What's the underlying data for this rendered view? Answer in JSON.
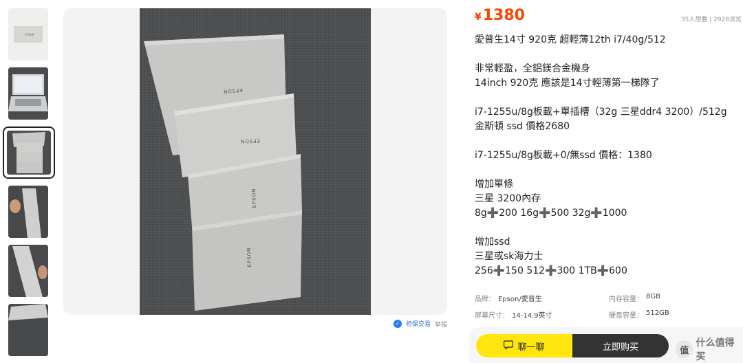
{
  "listing": {
    "currency_symbol": "¥",
    "price": "1380",
    "stats": "35人想要 | 2928浏览",
    "description": [
      "愛普生14寸 920克 超輕薄12th i7/40g/512",
      "",
      "非常輕盈，全鋁鎂合金機身",
      "14inch 920克 應該是14寸輕薄第一梯隊了",
      "",
      "i7-1255u/8g板載+單插槽（32g 三星ddr4 3200）/512g 金斯頓 ssd 價格2680",
      "",
      "i7-1255u/8g板載+0/無ssd 價格：1380",
      "",
      "增加單條",
      "三星 3200內存",
      "8g➕200 16g➕500 32g➕1000",
      "",
      "增加ssd",
      "三星或sk海力士",
      "256➕150 512➕300 1TB➕600"
    ]
  },
  "specs": {
    "brand_key": "品牌：",
    "brand_val": "Epson/愛普生",
    "memory_key": "内存容量：",
    "memory_val": "8GB",
    "screen_key": "屏幕尺寸：",
    "screen_val": "14-14.9英寸",
    "disk_key": "硬盘容量：",
    "disk_val": "512GB"
  },
  "photo": {
    "brand_text": "EPSON"
  },
  "share": {
    "label": "担保交易",
    "icon": "shield-check-icon",
    "report": "举报"
  },
  "actions": {
    "chat_label": "聊一聊",
    "chat_icon": "chat-bubble-icon",
    "buy_label": "立即购买"
  },
  "watermark": {
    "text": "什么值得买",
    "badge": "值"
  },
  "colors": {
    "price": "#ff4400",
    "chat_button": "#ffe60f",
    "buy_button": "#333333",
    "link": "#2468d8"
  }
}
